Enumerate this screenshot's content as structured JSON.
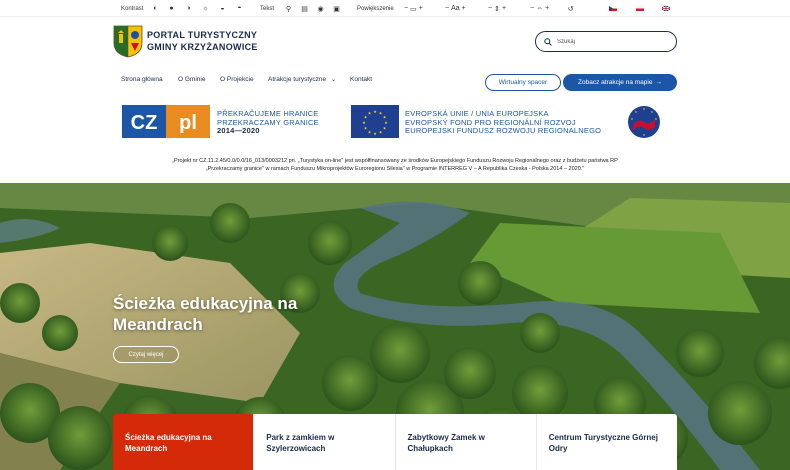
{
  "toolbar": {
    "contrast_label": "Kontrast",
    "text_label": "Tekst",
    "zoom_label": "Powiększenie",
    "font_glyph": "Aa",
    "minus": "−",
    "plus": "+"
  },
  "brand": {
    "line1": "PORTAL TURYSTYCZNY",
    "line2": "GMINY KRZYŻANOWICE"
  },
  "search": {
    "placeholder": "Szukaj"
  },
  "nav": {
    "items": [
      {
        "label": "Strona główna"
      },
      {
        "label": "O Gminie"
      },
      {
        "label": "O Projekcie"
      },
      {
        "label": "Atrakcje turystyczne"
      },
      {
        "label": "Kontakt"
      }
    ],
    "virtual_tour": "Wirtualny spacer",
    "map_button": "Zobacz atrakcje na mapie"
  },
  "project": {
    "cz_logo_cz": "CZ",
    "cz_logo_pl": "pl",
    "cz_line1": "PŘEKRAČUJEME HRANICE",
    "cz_line2": "PRZEKRACZAMY GRANICE",
    "cz_years": "2014—2020",
    "eu_line1": "EVROPSKÁ UNIE / UNIA EUROPEJSKA",
    "eu_line2": "EVROPSKÝ FOND PRO REGIONÁLNÍ ROZVOJ",
    "eu_line3": "EUROPEJSKI FUNDUSZ ROZWOJU REGIONALNEGO",
    "note_line1": "„Projekt nr CZ.11.2.45/0.0/0.0/16_013/0003212 pn. „Turystyka on-line\" jest współfinansowany ze środków Europejskiego Funduszu Rozwoju Regionalnego oraz z budżetu państwa RP",
    "note_line2": "„Przekraczamy granice\" w ramach Funduszu Mikroprojektów Euroregionu Silesia\" w Programie INTERREG V – A Republika Czeska - Polska 2014 – 2020.\""
  },
  "hero": {
    "title": "Ścieżka edukacyjna na Meandrach",
    "button": "Czytaj więcej"
  },
  "cards": [
    {
      "label": "Ścieżka edukacyjna na Meandrach",
      "active": true
    },
    {
      "label": "Park z zamkiem w Szylerzowicach",
      "active": false
    },
    {
      "label": "Zabytkowy Zamek w Chałupkach",
      "active": false
    },
    {
      "label": "Centrum Turystyczne Górnej Odry",
      "active": false
    }
  ],
  "colors": {
    "primary": "#1b57a6",
    "navy": "#1b2a4a",
    "active_card": "#d42a0a",
    "eu_blue": "#1f3f91"
  }
}
